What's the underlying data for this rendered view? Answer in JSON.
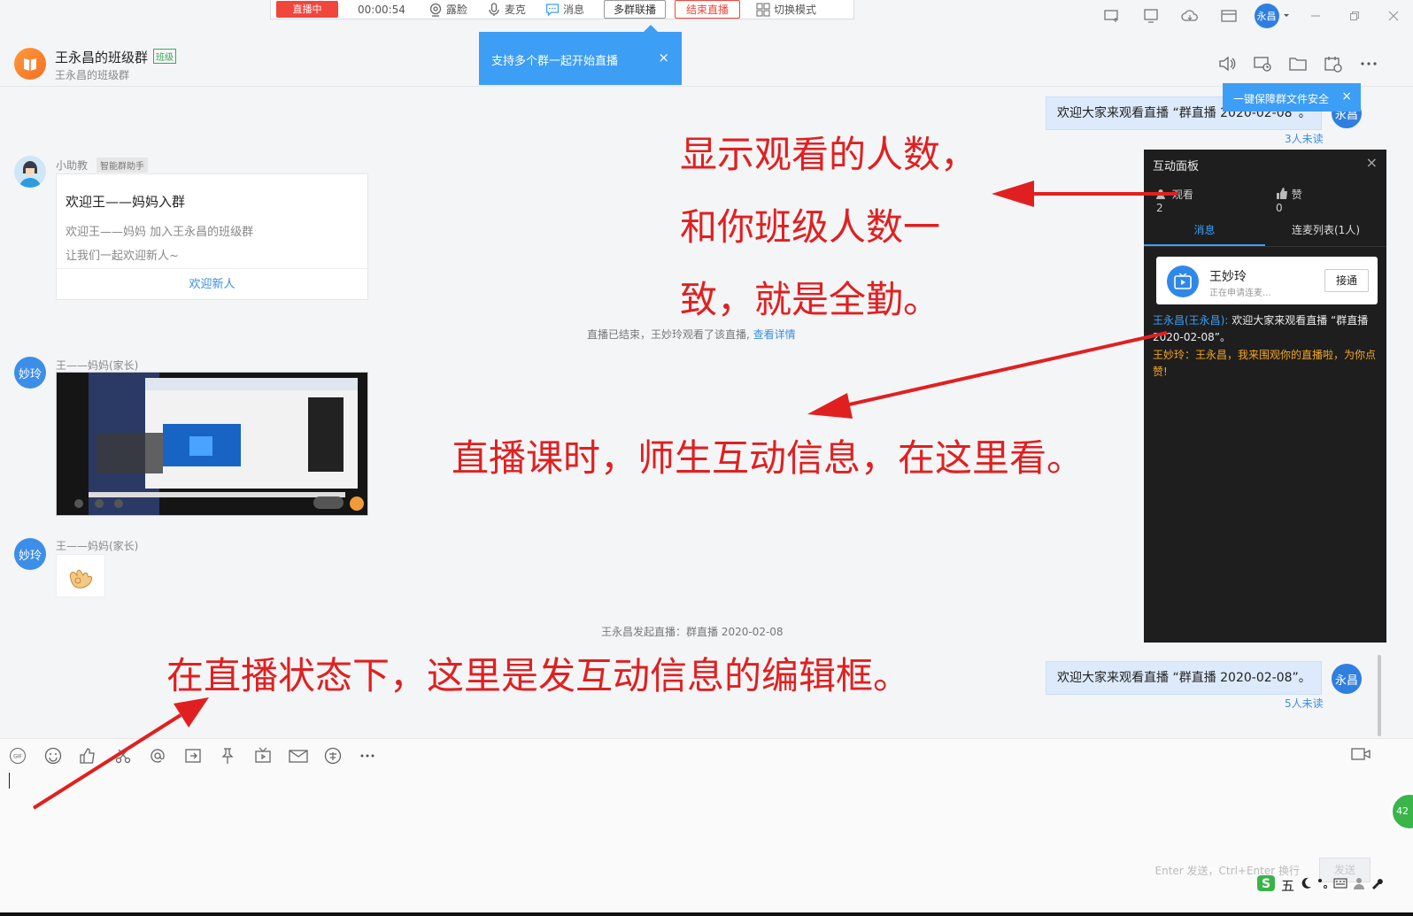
{
  "live_toolbar": {
    "live_label": "直播中",
    "timer": "00:00:54",
    "face_label": "露脸",
    "mic_label": "麦克",
    "message_label": "消息",
    "multi_group_label": "多群联播",
    "end_label": "结束直播",
    "switch_mode_label": "切换模式"
  },
  "top_user_avatar": "永昌",
  "header": {
    "group_name": "王永昌的班级群",
    "group_tag": "班级",
    "group_sub": "王永昌的班级群"
  },
  "tooltip_multi": {
    "text": "支持多个群一起开始直播",
    "close": "×"
  },
  "tooltip_secure": {
    "text": "一键保障群文件安全",
    "close": "×"
  },
  "messages": {
    "my_msg_top": {
      "text": "欢迎大家来观看直播 “群直播 2020-02-08”。",
      "avatar": "永昌",
      "unread": "3人未读"
    },
    "assistant": {
      "name": "小助教",
      "tag": "智能群助手",
      "card_title": "欢迎王——妈妈入群",
      "line1": "欢迎王——妈妈 加入王永昌的班级群",
      "line2": "让我们一起欢迎新人~",
      "button": "欢迎新人"
    },
    "sys_ended": "直播已结束，王妙玲观看了该直播, ",
    "sys_ended_link": "查看详情",
    "parent_1": {
      "avatar": "妙玲",
      "name": "王——妈妈(家长)"
    },
    "parent_2": {
      "avatar": "妙玲",
      "name": "王——妈妈(家长)"
    },
    "sys_started": "王永昌发起直播：群直播 2020-02-08",
    "my_msg_bottom": {
      "text": "欢迎大家来观看直播 “群直播 2020-02-08”。",
      "avatar": "永昌",
      "unread": "5人未读"
    }
  },
  "panel": {
    "title": "互动面板",
    "close": "×",
    "viewers": "观看 2",
    "likes": "赞 0",
    "tab_messages": "消息",
    "tab_mic_list": "连麦列表(1人)",
    "request_name": "王妙玲",
    "request_sub": "正在申请连麦...",
    "request_button": "接通",
    "msg1_name": "王永昌(王永昌):",
    "msg1_text": " 欢迎大家来观看直播 “群直播 2020-02-08”。",
    "msg2": "王妙玲：王永昌，我来围观你的直播啦，为你点赞!"
  },
  "input": {
    "send_hint": "Enter 发送，Ctrl+Enter 换行",
    "send_button": "发送",
    "ime_label": "五",
    "badge": "42"
  },
  "annotations": {
    "viewers_note": "显示观看的人数，和你班级人数一致，就是全勤。",
    "interaction_note": "直播课时，师生互动信息，在这里看。",
    "editor_note": "在直播状态下，这里是发互动信息的编辑框。"
  },
  "colors": {
    "accent": "#3d9ef5",
    "live_red": "#f0463c",
    "annotation_red": "#e02020",
    "panel_bg": "#1e1e1e"
  }
}
